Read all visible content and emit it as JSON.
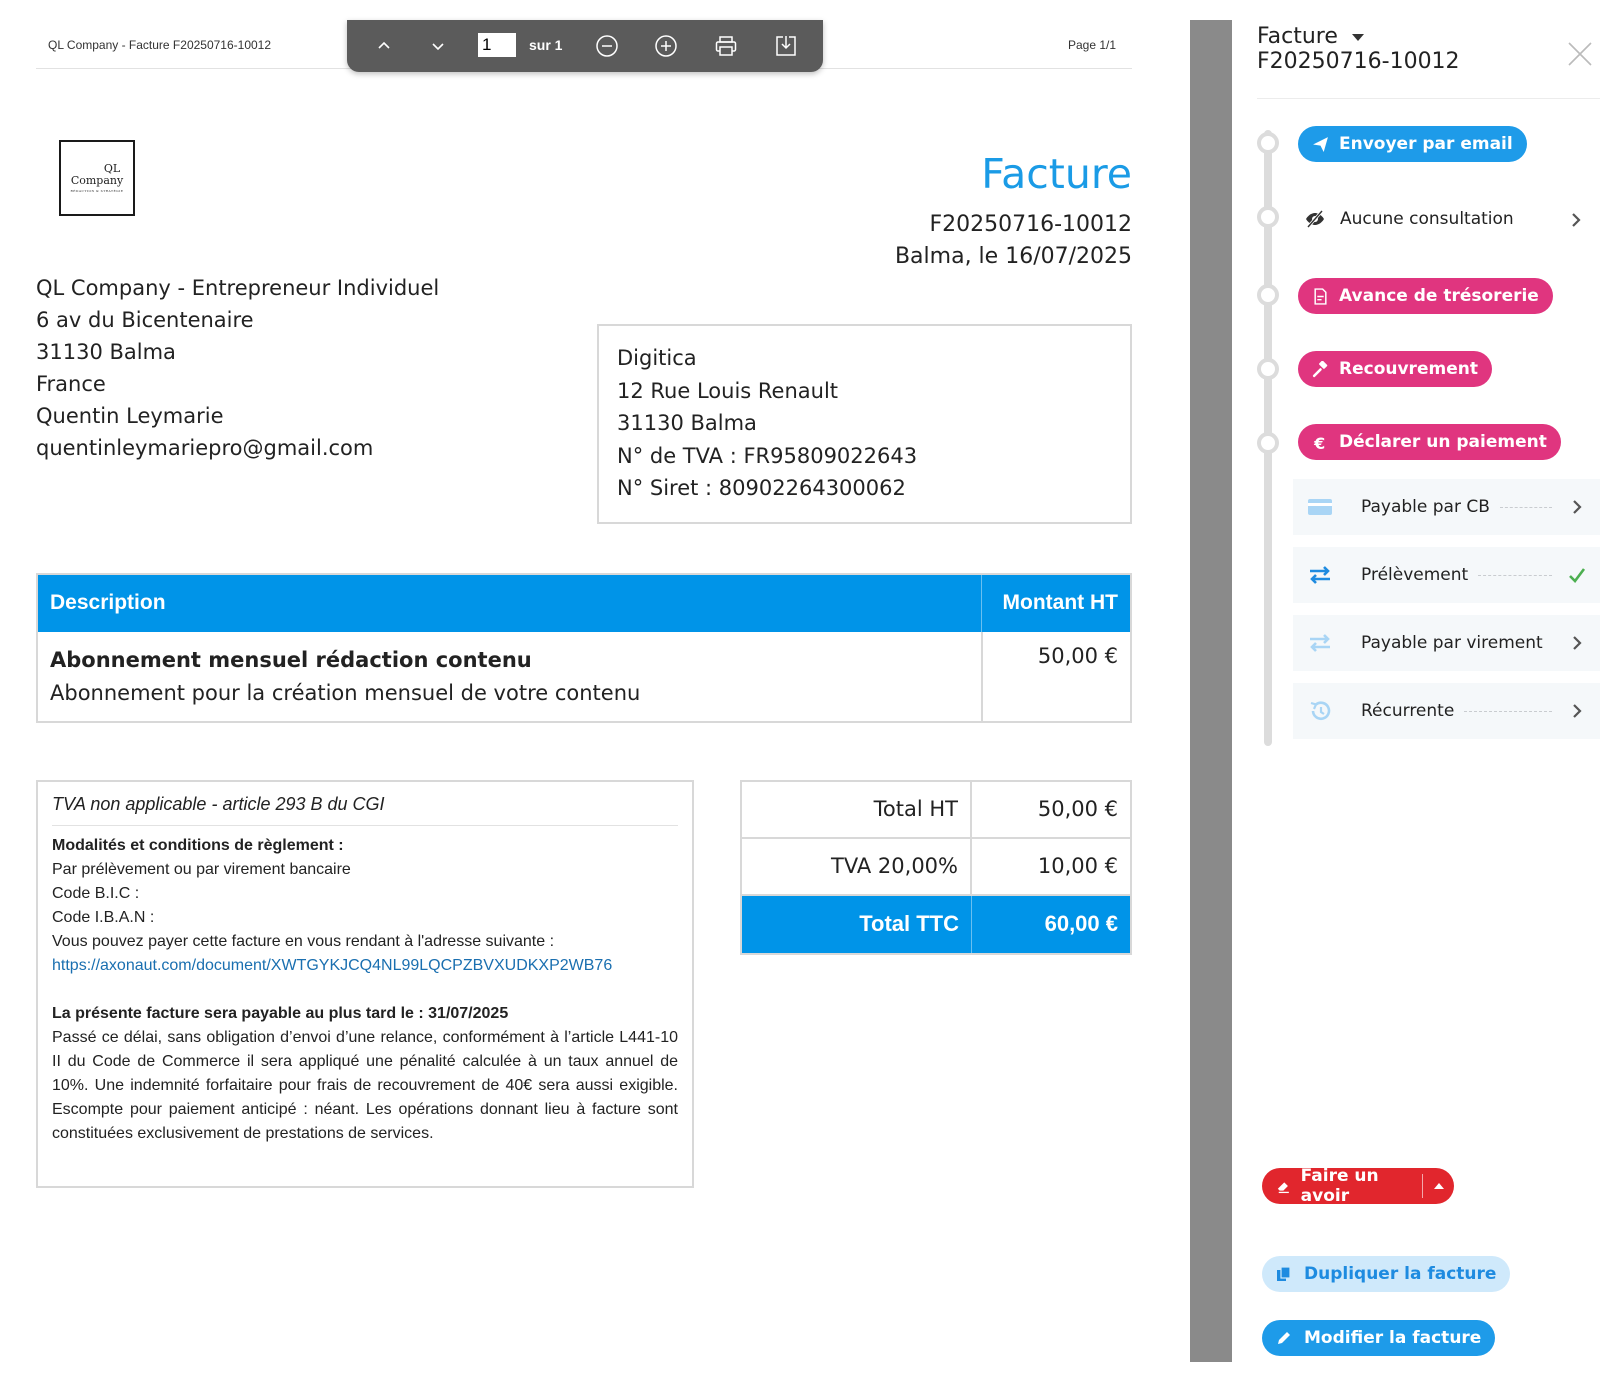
{
  "document": {
    "header_left": "QL Company - Facture F20250716-10012",
    "header_right": "Page 1/1"
  },
  "toolbar": {
    "current_page": "1",
    "total_pages": "sur 1"
  },
  "logo": {
    "line1": "QL",
    "line2": "Company",
    "line3": "RÉDACTION & STRATÉGIE"
  },
  "invoice": {
    "title": "Facture",
    "number": "F20250716-10012",
    "date": "Balma, le 16/07/2025"
  },
  "sender": {
    "lines": [
      "QL Company - Entrepreneur Individuel",
      "6 av du Bicentenaire",
      "31130 Balma",
      "France",
      "Quentin Leymarie",
      "quentinleymariepro@gmail.com"
    ]
  },
  "recipient": {
    "lines": [
      "Digitica",
      "12 Rue Louis Renault",
      "31130 Balma",
      "N° de TVA : FR95809022643",
      "N° Siret : 80902264300062"
    ]
  },
  "items": {
    "header": {
      "description": "Description",
      "amount": "Montant HT"
    },
    "rows": [
      {
        "title": "Abonnement mensuel rédaction contenu",
        "detail": "Abonnement pour la création mensuel de votre contenu",
        "amount": "50,00 €"
      }
    ]
  },
  "conditions": {
    "tva_note": "TVA non applicable - article 293 B du CGI",
    "modalities_title": "Modalités et conditions de règlement :",
    "modalities_line": "Par prélèvement ou par virement bancaire",
    "bic": "Code B.I.C :",
    "iban": "Code I.B.A.N :",
    "pay_online": "Vous pouvez payer cette facture en vous rendant à l'adresse suivante :",
    "link": "https://axonaut.com/document/XWTGYKJCQ4NL99LQCPZBVXUDKXP2WB76",
    "due_title": "La présente facture sera payable au plus tard le : 31/07/2025",
    "legal_text": "Passé ce délai, sans obligation d’envoi d’une relance, conformément à l’article L441-10 II du Code de Commerce il sera appliqué une pénalité calculée à un taux annuel de 10%. Une indemnité forfaitaire pour frais de recouvrement de 40€ sera aussi exigible. Escompte pour paiement anticipé : néant. Les opérations donnant lieu à facture sont constituées exclusivement de prestations de services."
  },
  "totals": {
    "ht_label": "Total HT",
    "ht_value": "50,00 €",
    "tva_label": "TVA 20,00%",
    "tva_value": "10,00 €",
    "ttc_label": "Total TTC",
    "ttc_value": "60,00 €"
  },
  "panel": {
    "title_line1": "Facture",
    "title_line2": "F20250716-10012",
    "send_email": "Envoyer par email",
    "consultation": "Aucune consultation",
    "treasury": "Avance de trésorerie",
    "recovery": "Recouvrement",
    "declare_payment": "Déclarer un paiement",
    "payment_methods": [
      {
        "label": "Payable par CB",
        "icon": "credit-card-icon",
        "status": "chevron"
      },
      {
        "label": "Prélèvement",
        "icon": "transfer-icon",
        "status": "check"
      },
      {
        "label": "Payable par virement",
        "icon": "transfer-icon",
        "status": "chevron"
      },
      {
        "label": "Récurrente",
        "icon": "history-icon",
        "status": "chevron"
      }
    ],
    "credit_note": "Faire un avoir",
    "duplicate": "Dupliquer la facture",
    "edit": "Modifier la facture"
  },
  "colors": {
    "accent_blue": "#0094e8",
    "pill_blue": "#1e9be9",
    "pill_pink": "#e0357f",
    "danger_red": "#e1262d",
    "success_green": "#4caf50"
  }
}
